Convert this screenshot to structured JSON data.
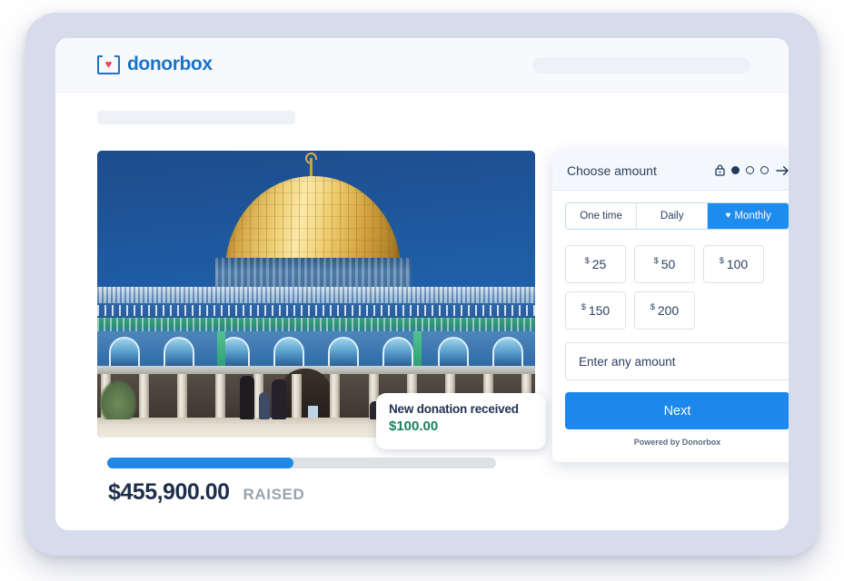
{
  "brand": {
    "name": "donorbox",
    "logo_icon": "donorbox-heart-box-icon",
    "accent_blue": "#1a73c9",
    "heart_red": "#e8445a"
  },
  "campaign": {
    "photo_alt": "dome-of-the-rock-photo",
    "toast": {
      "title": "New donation received",
      "amount": "$100.00",
      "amount_color": "#1c8160"
    },
    "progress": {
      "percent": 48,
      "fill_color": "#1d88e8",
      "track_color": "#dde1e6"
    },
    "raised_amount": "$455,900.00",
    "raised_label": "RAISED"
  },
  "form": {
    "header": {
      "title": "Choose amount",
      "lock_icon": "lock-icon",
      "arrow_icon": "arrow-right-icon",
      "steps": [
        {
          "state": "filled"
        },
        {
          "state": "empty"
        },
        {
          "state": "empty"
        }
      ]
    },
    "frequency": {
      "options": [
        {
          "label": "One time",
          "active": false
        },
        {
          "label": "Daily",
          "active": false
        },
        {
          "label": "Monthly",
          "active": true,
          "icon": "heart-icon"
        }
      ]
    },
    "amounts": [
      {
        "currency": "$",
        "value": "25"
      },
      {
        "currency": "$",
        "value": "50"
      },
      {
        "currency": "$",
        "value": "100"
      },
      {
        "currency": "$",
        "value": "150"
      },
      {
        "currency": "$",
        "value": "200"
      }
    ],
    "custom_amount_placeholder": "Enter any amount",
    "custom_amount_value": "",
    "next_label": "Next",
    "powered_by": "Powered by Donorbox",
    "button_color": "#1c87ec"
  }
}
